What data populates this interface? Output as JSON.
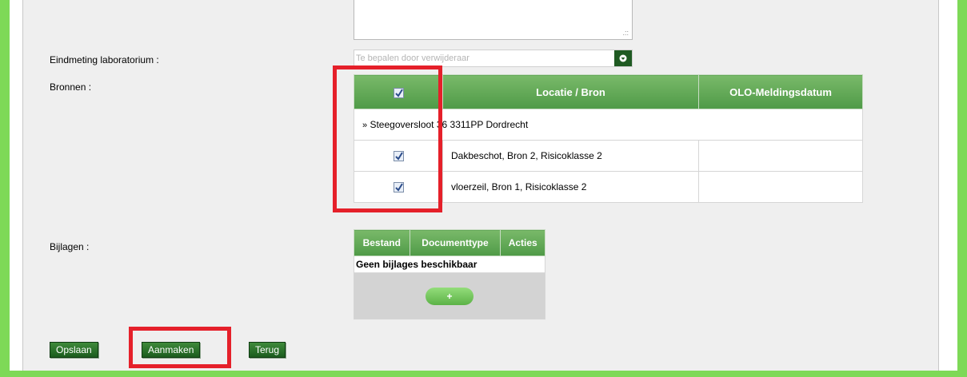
{
  "form": {
    "eindmeting_label": "Eindmeting laboratorium :",
    "eindmeting_placeholder": "Te bepalen door verwijderaar",
    "bronnen_label": "Bronnen :",
    "bijlagen_label": "Bijlagen :"
  },
  "bronnen_table": {
    "headers": [
      "",
      "Locatie / Bron",
      "OLO-Meldingsdatum"
    ],
    "group": {
      "expand_icon": "double-chevron-down-icon",
      "label": "Steegoversloot 36 3311PP Dordrecht"
    },
    "rows": [
      {
        "checked": true,
        "label": "Dakbeschot, Bron 2, Risicoklasse 2",
        "date": ""
      },
      {
        "checked": true,
        "label": "vloerzeil, Bron 1, Risicoklasse 2",
        "date": ""
      }
    ],
    "header_checked": true
  },
  "bijlagen_table": {
    "headers": [
      "Bestand",
      "Documenttype",
      "Acties"
    ],
    "empty_text": "Geen bijlages beschikbaar",
    "add_label": "+"
  },
  "buttons": {
    "opslaan": "Opslaan",
    "aanmaken": "Aanmaken",
    "terug": "Terug"
  },
  "colors": {
    "frame_green": "#7ed957",
    "header_green": "#5ea654",
    "button_green": "#2a6f2a",
    "highlight_red": "#e5202a"
  }
}
